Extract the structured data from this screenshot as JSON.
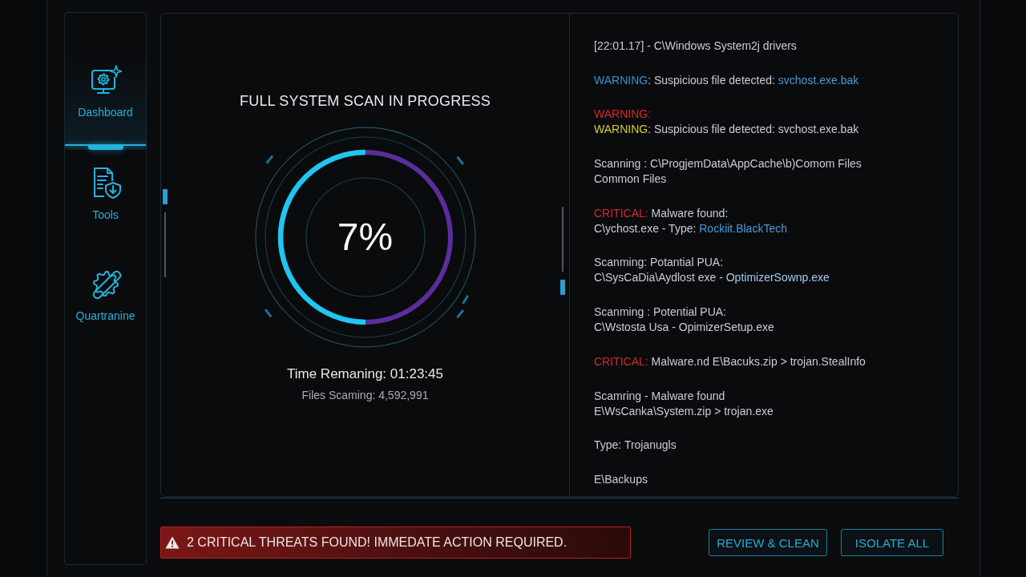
{
  "sidebar": {
    "items": [
      {
        "label": "Dashboard",
        "selected": true
      },
      {
        "label": "Tools",
        "selected": false
      },
      {
        "label": "Quartranine",
        "selected": false
      }
    ]
  },
  "scan": {
    "title": "FULL SYSTEM SCAN IN PROGRESS",
    "percent": "7%",
    "level": 0.5,
    "time_remaining": "Time Remaning: 01:23:45",
    "files_scanned": "Files Scaming: 4,592,991"
  },
  "log": {
    "entries": [
      {
        "lines": [
          {
            "segments": [
              {
                "text": "[22:01.17] - C\\Windows System2j drivers"
              }
            ]
          }
        ]
      },
      {
        "lines": [
          {
            "segments": [
              {
                "text": "WARNING",
                "color": "#3d8fd0"
              },
              {
                "text": ": Suspicious file detected: "
              },
              {
                "text": "svchost.exe.bak",
                "color": "#4a9ad6"
              }
            ]
          }
        ]
      },
      {
        "lines": [
          {
            "segments": [
              {
                "text": "WARNING:",
                "color": "#d42a2a"
              }
            ]
          },
          {
            "segments": [
              {
                "text": "WARNING:",
                "color": "#d6c93a"
              },
              {
                "text": " Suspicious file detected: svchost.exe.bak"
              }
            ]
          }
        ]
      },
      {
        "lines": [
          {
            "segments": [
              {
                "text": "Scanning : C\\ProgjemData\\AppCache\\b)Comom Files"
              }
            ]
          },
          {
            "segments": [
              {
                "text": "Common Files"
              }
            ]
          }
        ]
      },
      {
        "lines": [
          {
            "segments": [
              {
                "text": "CRITICAL:",
                "color": "#d42a2a"
              },
              {
                "text": " Malware found:"
              }
            ]
          },
          {
            "segments": [
              {
                "text": "C\\ychost.exe - Type: "
              },
              {
                "text": "Rockiit.BlackTech",
                "color": "#4a9ad6"
              }
            ]
          }
        ]
      },
      {
        "lines": [
          {
            "segments": [
              {
                "text": "Scanming: Potantial PUA:"
              }
            ]
          },
          {
            "segments": [
              {
                "text": "C\\SysCaDia\\Aydlost exe - "
              },
              {
                "text": "OptimizerSownp.exe",
                "color": "#a9cbe6"
              }
            ]
          }
        ]
      },
      {
        "lines": [
          {
            "segments": [
              {
                "text": "Scanming : Potential PUA:"
              }
            ]
          },
          {
            "segments": [
              {
                "text": "C\\Wstosta Usa - OpimizerSetup.exe"
              }
            ]
          }
        ]
      },
      {
        "lines": [
          {
            "segments": [
              {
                "text": "CRITICAL:",
                "color": "#d42a2a"
              },
              {
                "text": " Malware.nd E\\Bacuks.zip > trojan.StealInfo"
              }
            ]
          }
        ]
      },
      {
        "lines": [
          {
            "segments": [
              {
                "text": "Scamring - Malware found"
              }
            ]
          },
          {
            "segments": [
              {
                "text": "E\\WsCanka\\System.zip > trojan.exe"
              }
            ]
          }
        ]
      },
      {
        "lines": [
          {
            "segments": [
              {
                "text": "Type: Trojanugls"
              }
            ]
          }
        ]
      },
      {
        "lines": [
          {
            "segments": [
              {
                "text": "E\\Backups"
              }
            ]
          }
        ]
      }
    ]
  },
  "alert": {
    "message": "2 CRITICAL THREATS FOUND! IMMEDATE ACTION REQUIRED."
  },
  "buttons": [
    "REVIEW & CLEAN",
    "ISOLATE ALL"
  ]
}
